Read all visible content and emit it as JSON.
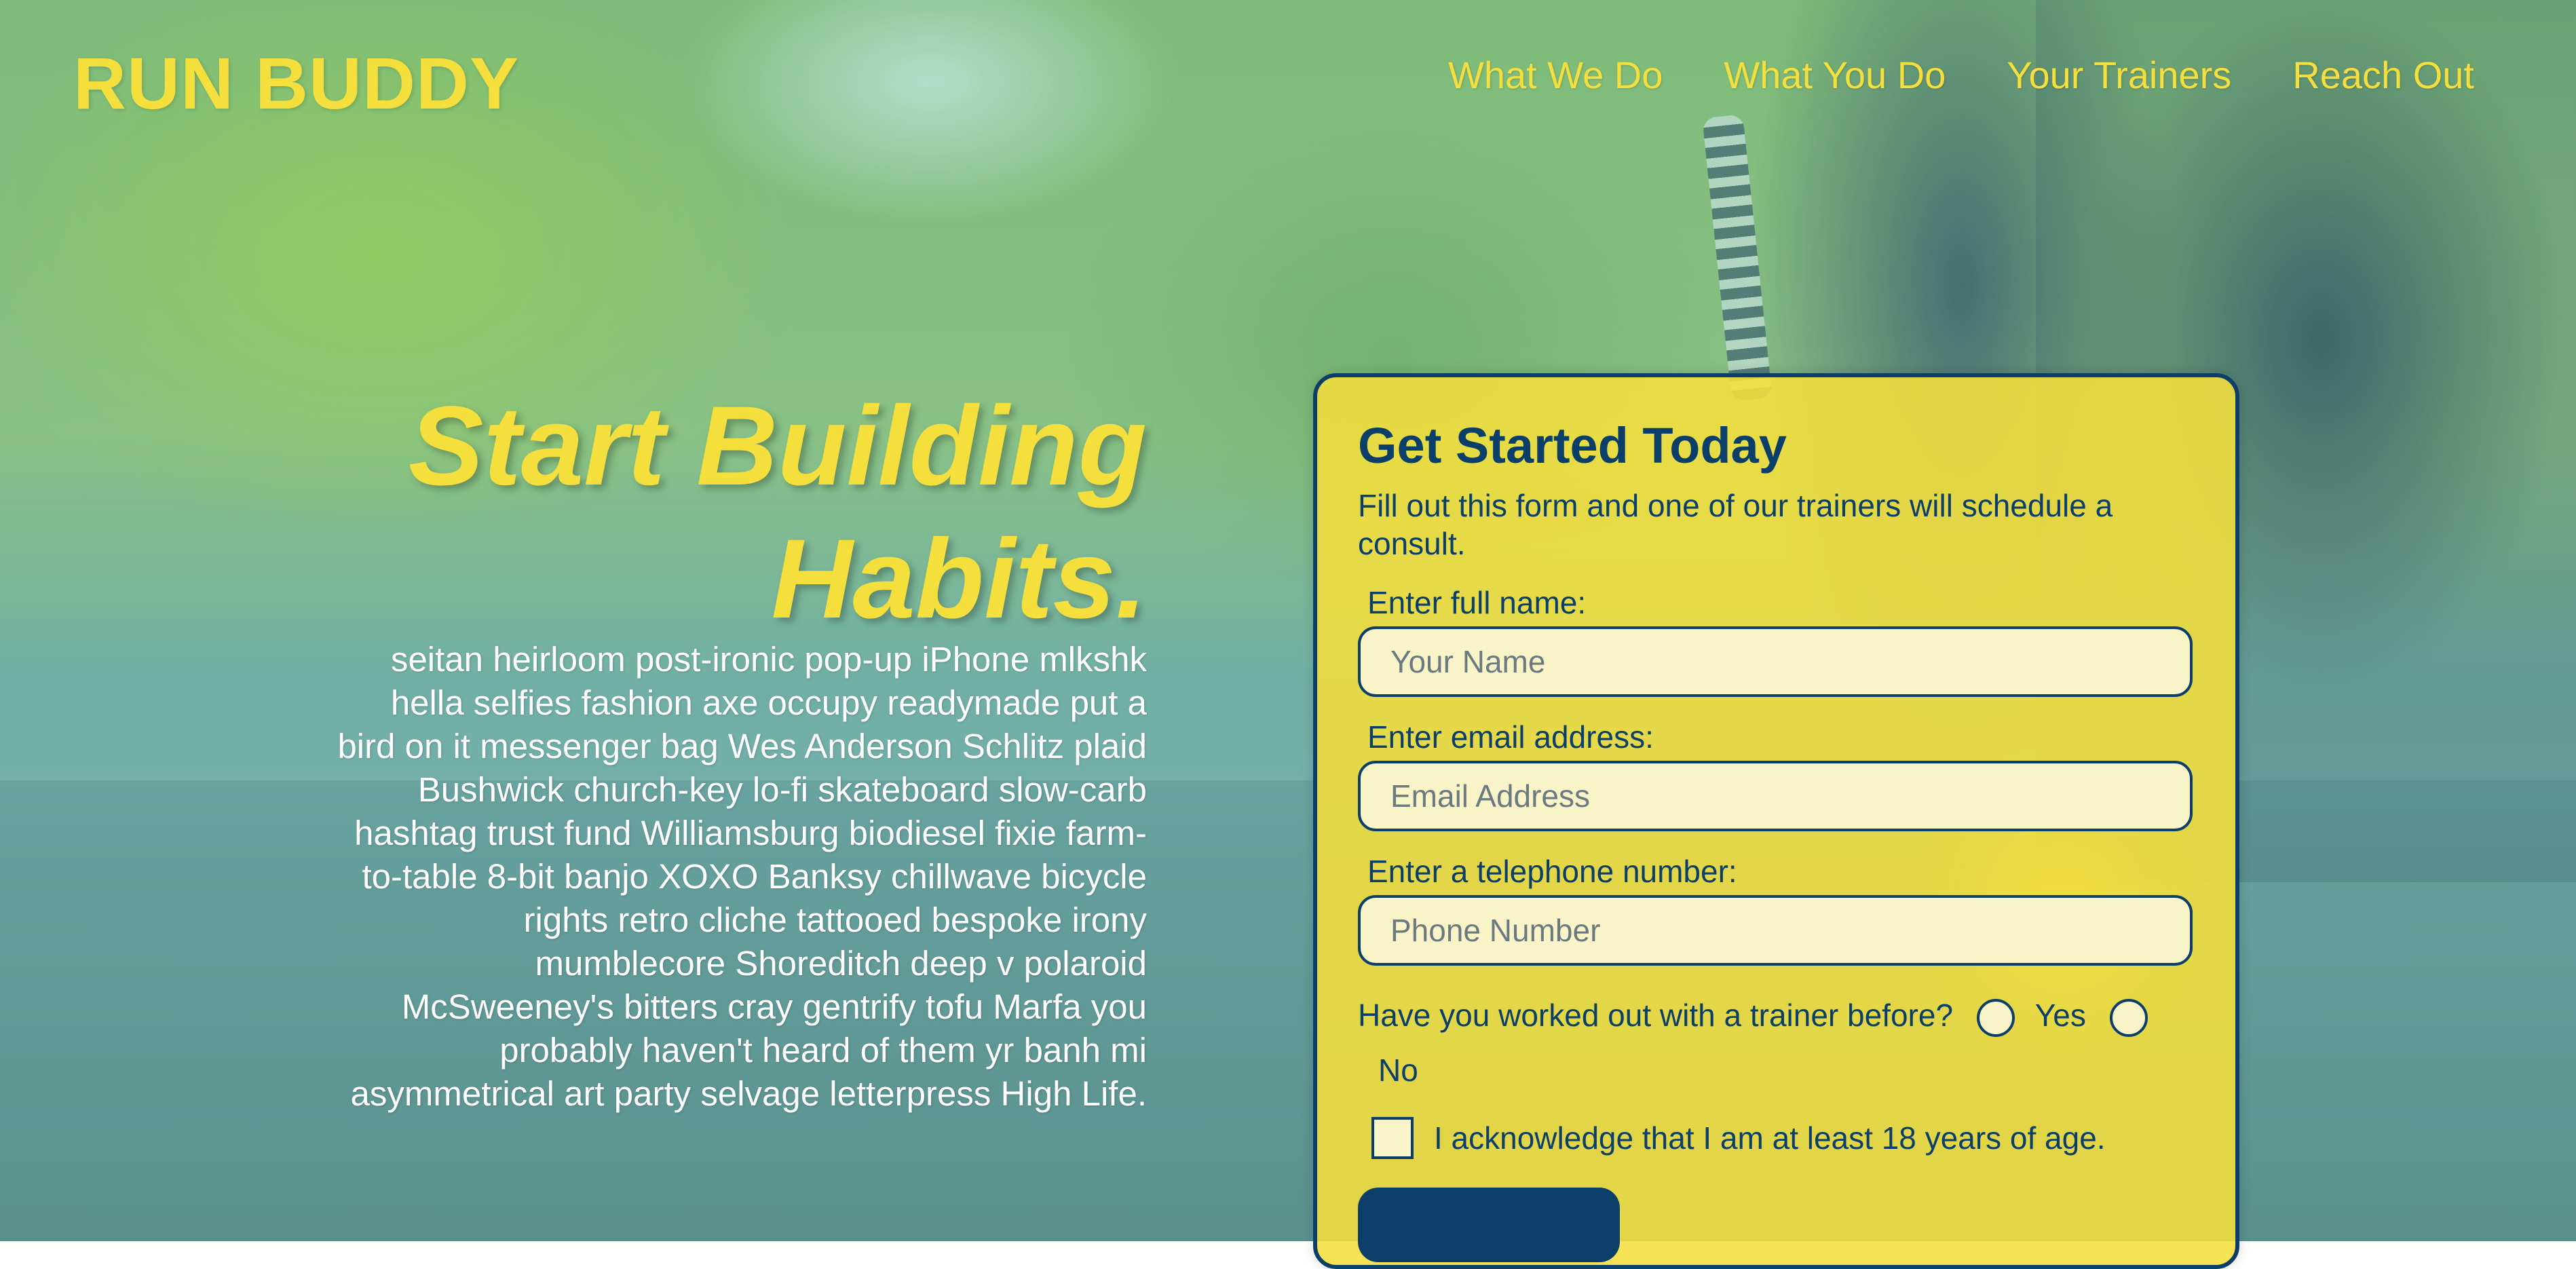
{
  "header": {
    "logo": "RUN BUDDY",
    "nav": [
      "What We Do",
      "What You Do",
      "Your Trainers",
      "Reach Out"
    ]
  },
  "hero": {
    "title_line1": "Start Building",
    "title_line2": "Habits.",
    "text": "seitan heirloom post-ironic pop-up iPhone mlkshk hella selfies fashion axe occupy readymade put a bird on it messenger bag Wes Anderson Schlitz plaid Bushwick church-key lo-fi skateboard slow-carb hashtag trust fund Williamsburg biodiesel fixie farm-to-table 8-bit banjo XOXO Banksy chillwave bicycle rights retro cliche tattooed bespoke irony mumblecore Shoreditch deep v polaroid McSweeney's bitters cray gentrify tofu Marfa you probably haven't heard of them yr banh mi asymmetrical art party selvage letterpress High Life."
  },
  "form": {
    "title": "Get Started Today",
    "intro": "Fill out this form and one of our trainers will schedule a consult.",
    "name_label": "Enter full name:",
    "name_placeholder": "Your Name",
    "email_label": "Enter email address:",
    "email_placeholder": "Email Address",
    "phone_label": "Enter a telephone number:",
    "phone_placeholder": "Phone Number",
    "question": "Have you worked out with a trainer before?",
    "option_yes": "Yes",
    "option_no": "No",
    "acknowledge": "I acknowledge that I am at least 18 years of age.",
    "submit": ""
  },
  "colors": {
    "accent_yellow": "#f5df3d",
    "navy": "#0b3f69",
    "input_bg": "#f8f4c8"
  }
}
